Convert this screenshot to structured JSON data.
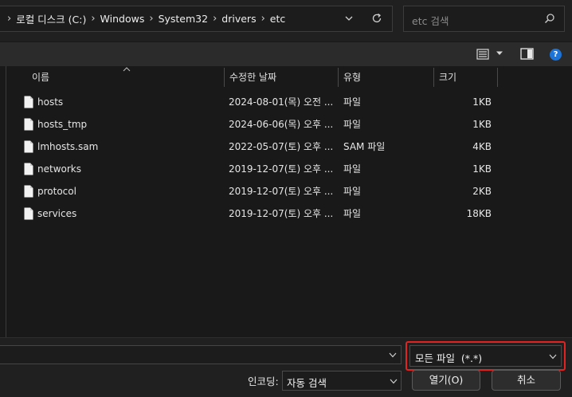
{
  "address": {
    "breadcrumbs": [
      "로컬 디스크 (C:)",
      "Windows",
      "System32",
      "drivers",
      "etc"
    ]
  },
  "search": {
    "placeholder": "etc 검색"
  },
  "icons": {
    "address_dropdown": "chevron-down-icon",
    "refresh": "refresh-icon",
    "search": "search-icon",
    "view_menu": "view-options-icon",
    "preview_pane": "preview-pane-icon",
    "help": "help-icon",
    "file": "file-icon"
  },
  "toolbar": {
    "help_label": "?"
  },
  "columns": {
    "name": "이름",
    "date": "수정한 날짜",
    "type": "유형",
    "size": "크기"
  },
  "files": [
    {
      "name": "hosts",
      "date": "2024-08-01(목) 오전 ...",
      "type": "파일",
      "size": "1KB"
    },
    {
      "name": "hosts_tmp",
      "date": "2024-06-06(목) 오후 ...",
      "type": "파일",
      "size": "1KB"
    },
    {
      "name": "lmhosts.sam",
      "date": "2022-05-07(토) 오후 ...",
      "type": "SAM 파일",
      "size": "4KB"
    },
    {
      "name": "networks",
      "date": "2019-12-07(토) 오후 ...",
      "type": "파일",
      "size": "1KB"
    },
    {
      "name": "protocol",
      "date": "2019-12-07(토) 오후 ...",
      "type": "파일",
      "size": "2KB"
    },
    {
      "name": "services",
      "date": "2019-12-07(토) 오후 ...",
      "type": "파일",
      "size": "18KB"
    }
  ],
  "bottom": {
    "filename_value": "",
    "file_type_filter": "모든 파일  (*.*)",
    "encoding_label": "인코딩:",
    "encoding_value": "자동 검색",
    "open_button": "열기(O)",
    "cancel_button": "취소"
  },
  "colors": {
    "background": "#191919",
    "toolbar": "#2b2b2b",
    "highlight_border": "#e32222",
    "help_blue": "#1c73d8"
  }
}
